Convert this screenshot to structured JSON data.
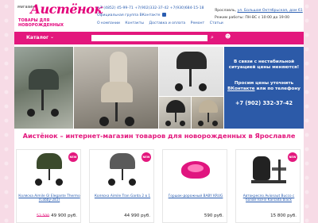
{
  "header": {
    "logo_small": "магазин",
    "logo_big": "Аистёнок",
    "logo_sub": "ТОВАРЫ ДЛЯ НОВОРОЖДЕННЫХ",
    "phones": "+7 (4852) 45-99-71   +7(902)332-37-42   +7(930)684-15-18",
    "group": "Официальная группа ВКонтакте",
    "nav": [
      "О компании",
      "Контакты",
      "Доставка и оплата",
      "Ремонт",
      "Статьи"
    ],
    "address_label": "Ярославль, ",
    "address_link": "ул. Большая Октябрьская, дом 61",
    "hours": "Режим работы: ПН-ВС с 10:00 до 19:00"
  },
  "bar": {
    "catalog_label": "Каталог",
    "search_placeholder": ""
  },
  "promo": {
    "line1": "В связи с нестабильной ситуацией цены меняются!",
    "line2_a": "Просим цены уточнить ",
    "line2_link": "ВКонтакте",
    "line2_b": " или по телефону",
    "phone": "+7 (902) 332-37-42"
  },
  "heading": "Аистёнок – интернет-магазин товаров для новорожденных в Ярославле",
  "products": [
    {
      "name": "Коляска Aimile Gl Elegante Thermo (Cobby-2в1)",
      "old_price": "52 500",
      "price": "49 900 руб.",
      "badge": "NEW",
      "color": "#3b4a2c"
    },
    {
      "name": "Коляска Aimile Tran Garda 2 в 1",
      "old_price": "",
      "price": "44 990 руб.",
      "badge": "NEW",
      "color": "#555555"
    },
    {
      "name": "Горшок-дорожный BABY KRUG",
      "old_price": "",
      "price": "590 руб.",
      "badge": "",
      "color": "#e0157f"
    },
    {
      "name": "Автокресло Avionaut Bucco с базой IsoFix Karsada black",
      "old_price": "",
      "price": "15 800 руб.",
      "badge": "NEW",
      "color": "#222222"
    }
  ]
}
